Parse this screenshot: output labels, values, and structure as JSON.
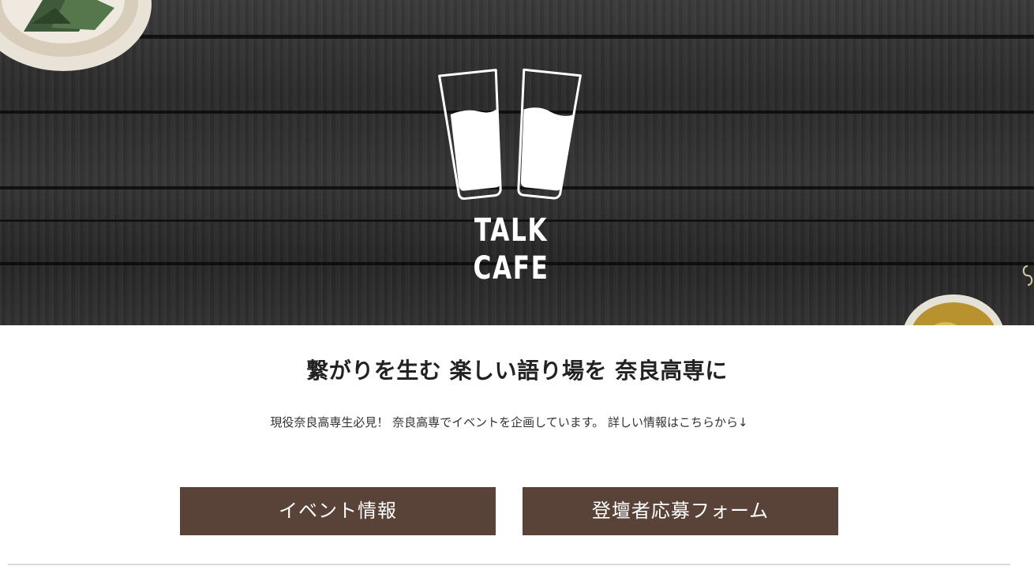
{
  "hero": {
    "logo_text": "TALK CAFE",
    "logo_icon": "two-glasses-toast-icon"
  },
  "main": {
    "headline": "繋がりを生む 楽しい語り場を 奈良高専に",
    "subline": "現役奈良高専生必見！ 奈良高専でイベントを企画しています。 詳しい情報はこちらから↓"
  },
  "buttons": {
    "event_label": "イベント情報",
    "form_label": "登壇者応募フォーム"
  },
  "colors": {
    "button_bg": "#594339",
    "hero_bg": "#2c2c2c",
    "text": "#222222"
  }
}
